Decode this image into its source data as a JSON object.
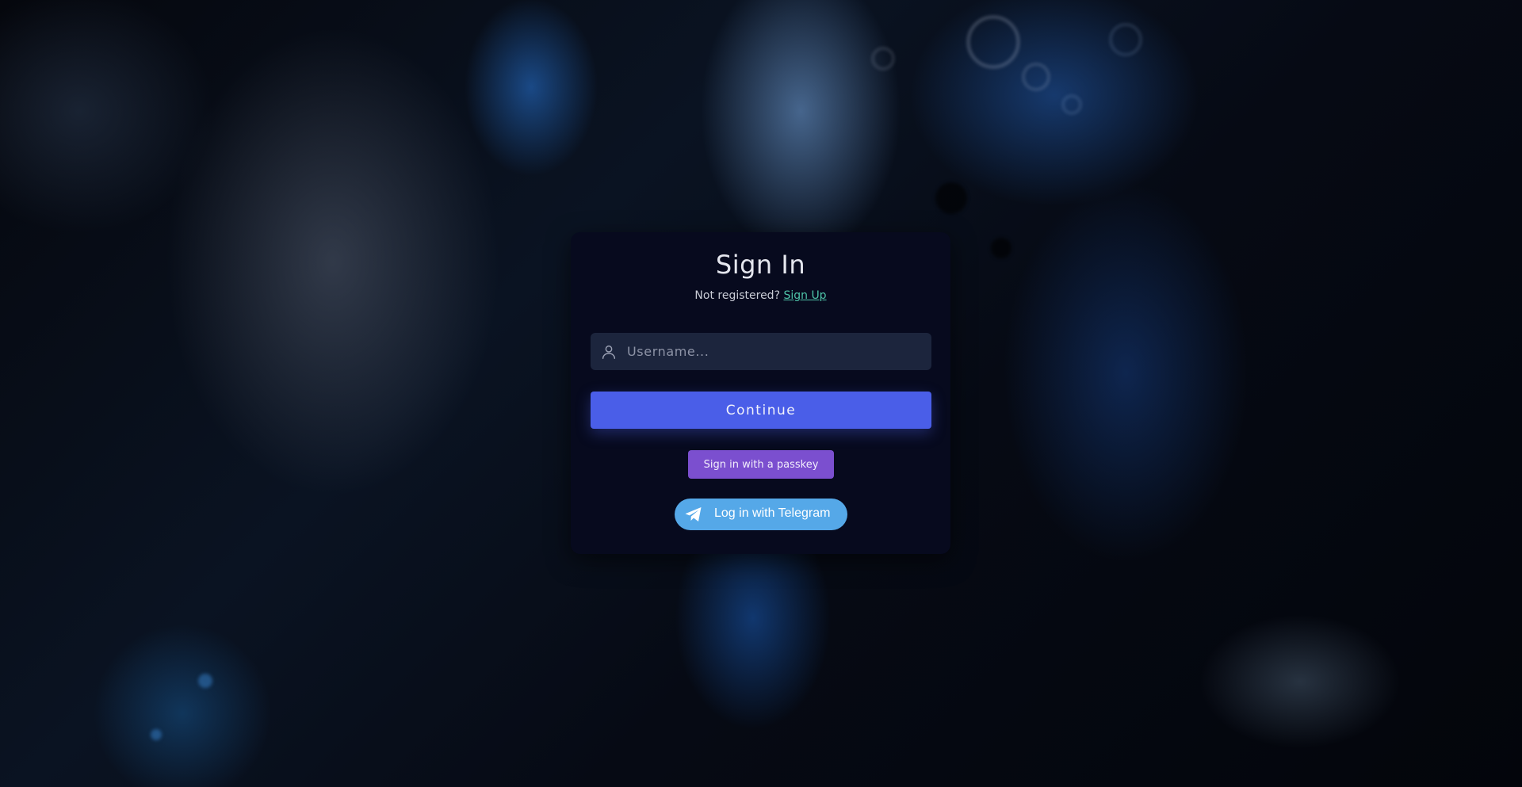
{
  "login": {
    "title": "Sign In",
    "register_prompt": "Not registered?",
    "register_link": "Sign Up",
    "username_placeholder": "Username...",
    "username_value": "",
    "username_icon": "user-icon",
    "continue_label": "Continue",
    "passkey_label": "Sign in with a passkey",
    "telegram_label": "Log in with Telegram",
    "telegram_icon": "telegram-plane-icon"
  },
  "colors": {
    "card_background": "#070a1e",
    "input_background": "#1c253d",
    "continue_button": "#4a5ee8",
    "passkey_button": "#7b4fcf",
    "telegram_button": "#55a8e8",
    "link": "#4ec3a8"
  }
}
